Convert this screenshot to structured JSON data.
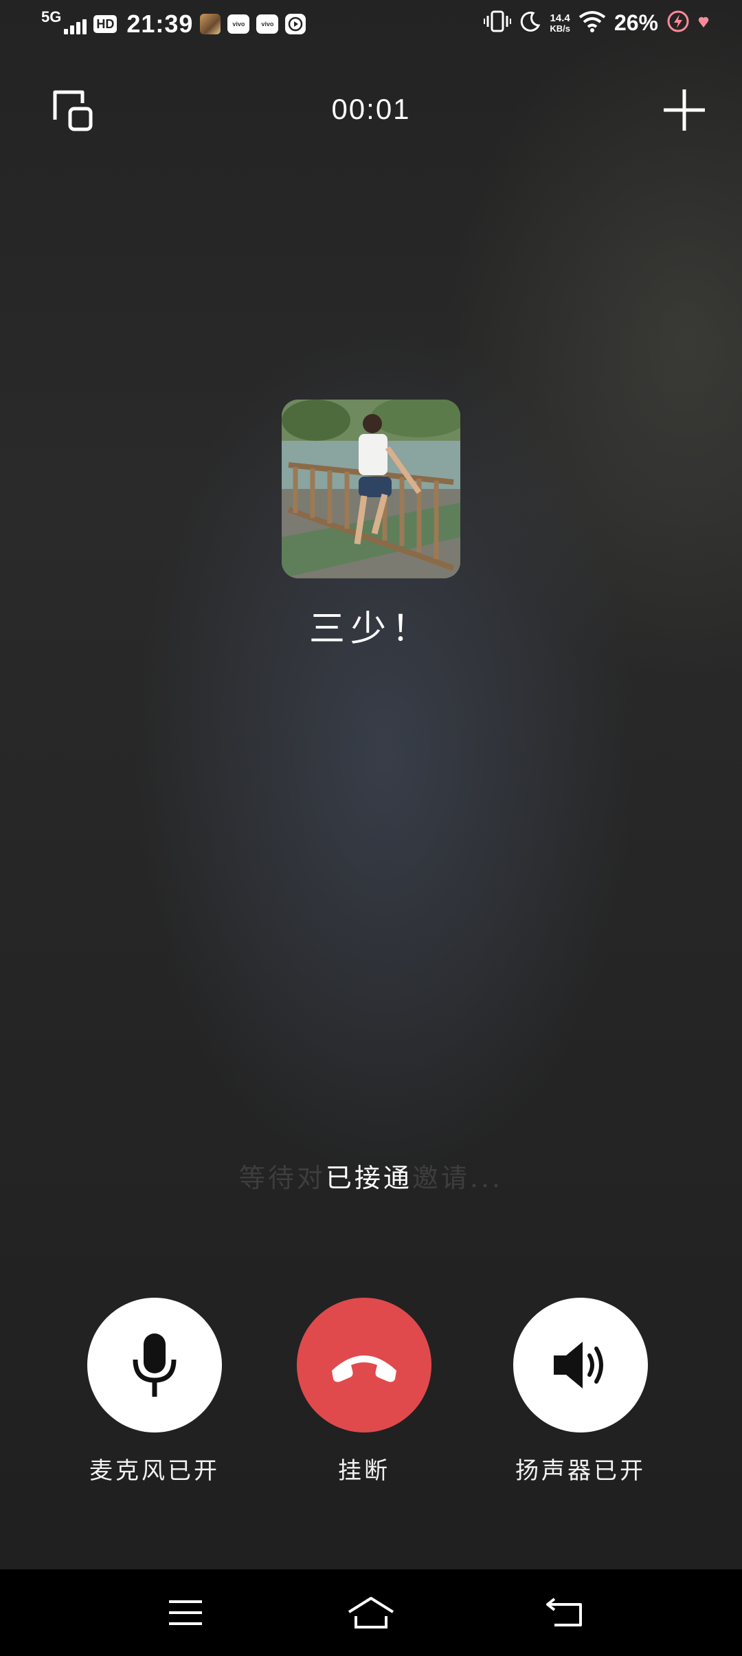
{
  "status_bar": {
    "network": "5G",
    "hd": "HD",
    "time": "21:39",
    "app_icons": [
      "game-app-icon",
      "vivo-icon",
      "vivo-icon",
      "play-icon"
    ],
    "app_icon_text": "vivo",
    "net_speed_value": "14.4",
    "net_speed_unit": "KB/s",
    "battery": "26%"
  },
  "call": {
    "timer": "00:01",
    "contact_name": "三少！",
    "status_ghost_left": "等待对",
    "status": "已接通",
    "status_ghost_right": "邀请..."
  },
  "controls": {
    "mic_label": "麦克风已开",
    "hangup_label": "挂断",
    "speaker_label": "扬声器已开"
  },
  "colors": {
    "hangup": "#e04a4d",
    "background": "#262626",
    "navbar": "#000000"
  }
}
